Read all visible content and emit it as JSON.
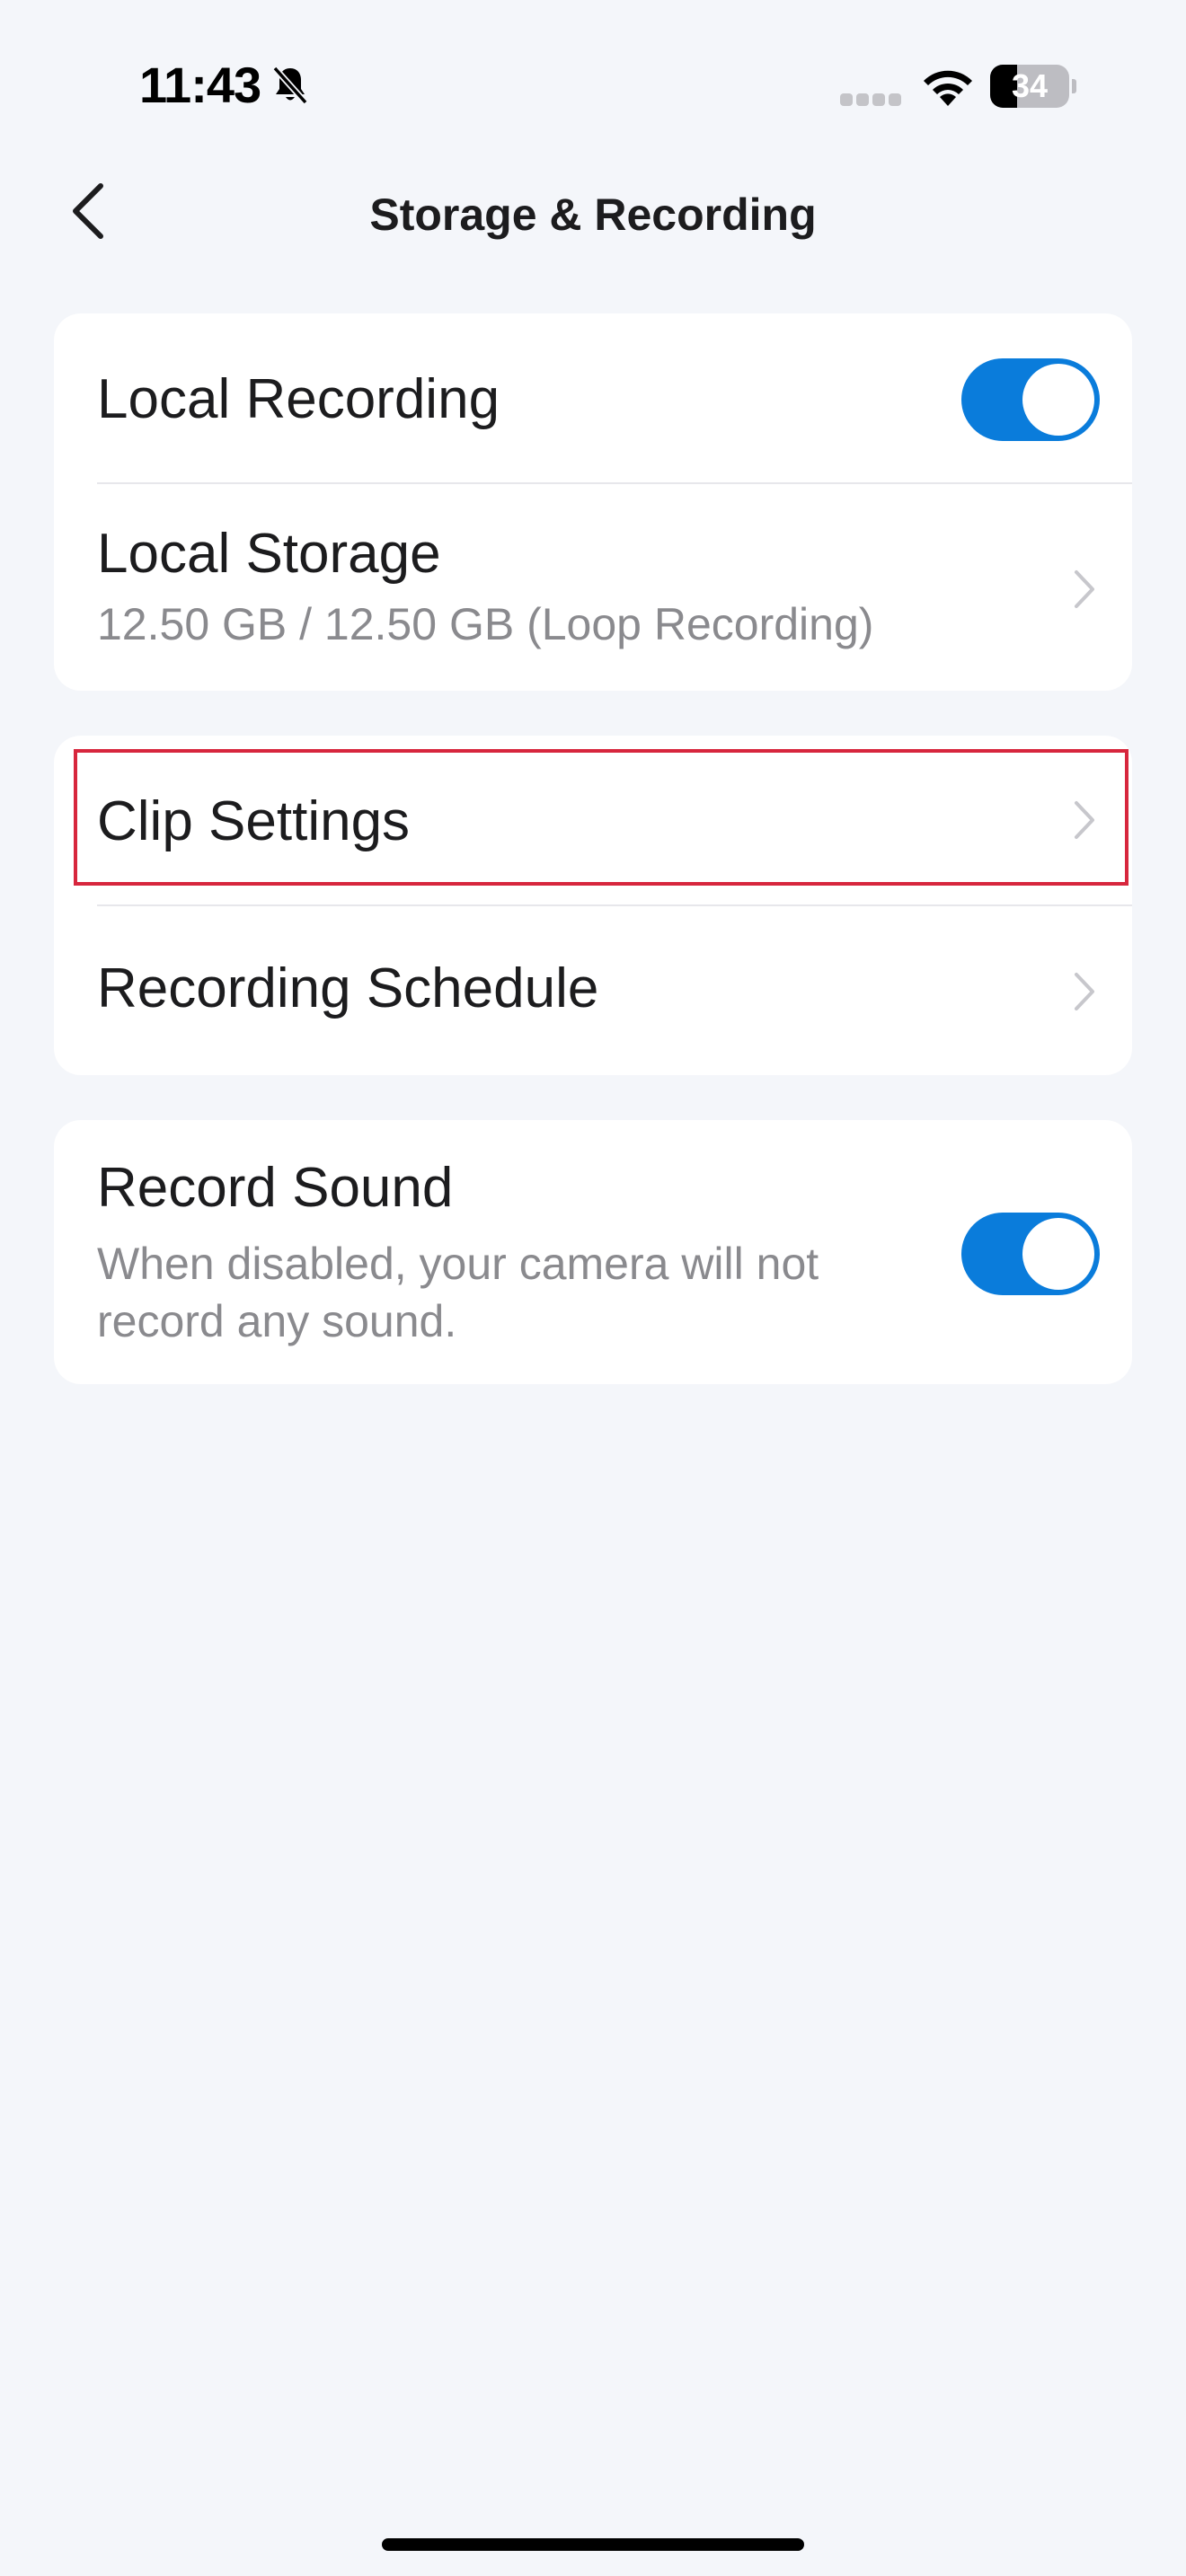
{
  "status_bar": {
    "time": "11:43",
    "battery_level": "34",
    "battery_fraction": 0.34,
    "icons": [
      "bell-slash-icon",
      "signal-icon",
      "wifi-icon",
      "battery-icon"
    ]
  },
  "nav": {
    "title": "Storage & Recording",
    "back_icon": "chevron-left-icon"
  },
  "sections": {
    "storage": {
      "local_recording": {
        "label": "Local Recording",
        "enabled": true
      },
      "local_storage": {
        "label": "Local Storage",
        "detail": "12.50 GB / 12.50 GB (Loop Recording)"
      }
    },
    "clips": {
      "clip_settings": {
        "label": "Clip Settings"
      },
      "recording_schedule": {
        "label": "Recording Schedule"
      }
    },
    "sound": {
      "record_sound": {
        "label": "Record Sound",
        "description": "When disabled, your camera will not record any sound.",
        "enabled": true
      }
    }
  },
  "colors": {
    "accent": "#0A7CDB",
    "background": "#F4F6FA",
    "highlight": "#D7263D"
  }
}
